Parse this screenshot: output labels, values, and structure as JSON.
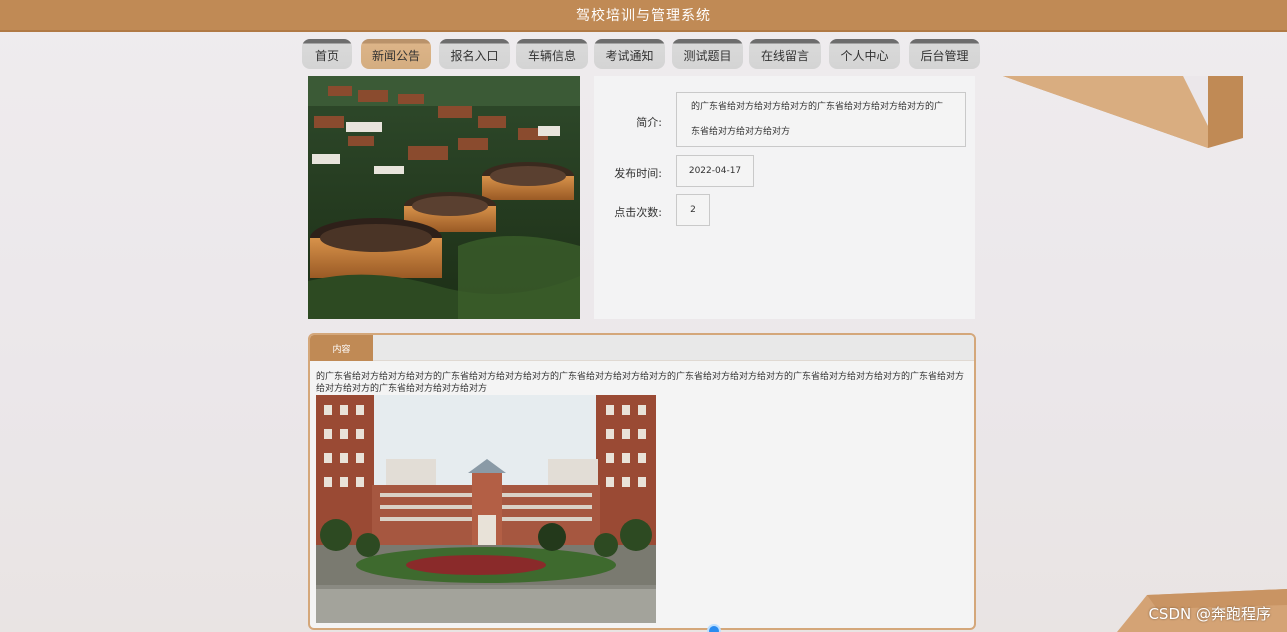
{
  "header": {
    "title": "驾校培训与管理系统"
  },
  "nav": {
    "items": [
      {
        "label": "首页"
      },
      {
        "label": "新闻公告"
      },
      {
        "label": "报名入口"
      },
      {
        "label": "车辆信息"
      },
      {
        "label": "考试通知"
      },
      {
        "label": "测试题目"
      },
      {
        "label": "在线留言"
      },
      {
        "label": "个人中心"
      },
      {
        "label": "后台管理"
      }
    ],
    "active": "新闻公告"
  },
  "detail": {
    "summary_label": "简介:",
    "summary_value": "的广东省给对方给对方给对方的广东省给对方给对方给对方的广东省给对方给对方给对方",
    "publish_label": "发布时间:",
    "publish_value": "2022-04-17",
    "clicks_label": "点击次数:",
    "clicks_value": "2"
  },
  "content": {
    "tab_label": "内容",
    "text": "的广东省给对方给对方给对方的广东省给对方给对方给对方的广东省给对方给对方给对方的广东省给对方给对方给对方的广东省给对方给对方给对方的广东省给对方给对方给对方的广东省给对方给对方给对方"
  },
  "watermark": "CSDN @奔跑程序",
  "colors": {
    "accent": "#c08a55",
    "nav_active": "#d4ad80",
    "nav_inactive": "#d4d4d4",
    "panel_border": "#d4a77a"
  }
}
